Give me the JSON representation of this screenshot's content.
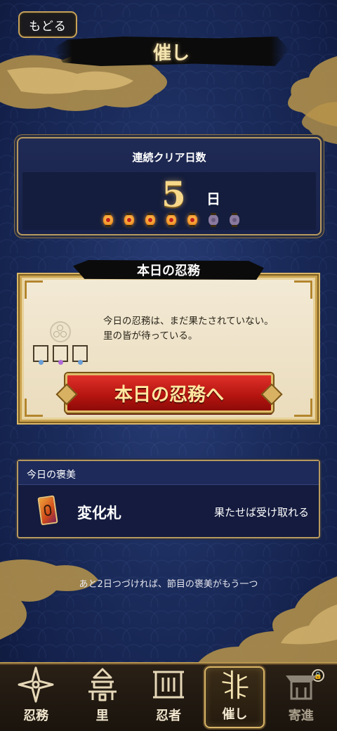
{
  "header": {
    "back_label": "もどる",
    "title": "催し"
  },
  "streak": {
    "label": "連続クリア日数",
    "count": "5",
    "unit": "日",
    "lanterns": [
      {
        "state": "on"
      },
      {
        "state": "on"
      },
      {
        "state": "on"
      },
      {
        "state": "on"
      },
      {
        "state": "on"
      },
      {
        "state": "off"
      },
      {
        "state": "off"
      }
    ]
  },
  "mission": {
    "header": "本日の忍務",
    "description_line1": "今日の忍務は、まだ果たされていない。",
    "description_line2": "里の皆が待っている。",
    "slot_gem_colors": [
      "#6aa0d8",
      "#b06ad8",
      "#6aa0d8"
    ],
    "button_label": "本日の忍務へ"
  },
  "reward": {
    "header": "今日の褒美",
    "item_name": "変化札",
    "condition": "果たせば受け取れる"
  },
  "footnote": "あと2日つづければ、節目の褒美がもう一つ",
  "nav": {
    "items": [
      {
        "label": "忍務",
        "icon": "shuriken-icon",
        "state": "normal"
      },
      {
        "label": "里",
        "icon": "pagoda-icon",
        "state": "normal"
      },
      {
        "label": "忍者",
        "icon": "scroll-icon",
        "state": "normal"
      },
      {
        "label": "催し",
        "icon": "bamboo-icon",
        "state": "active"
      },
      {
        "label": "寄進",
        "icon": "shrine-icon",
        "state": "locked"
      }
    ]
  },
  "colors": {
    "gold": "#d9b667",
    "background": "#1b2c5c",
    "button_red": "#b3140f",
    "lantern_on": "#f08b1d",
    "lantern_off": "#8a7aa0"
  }
}
